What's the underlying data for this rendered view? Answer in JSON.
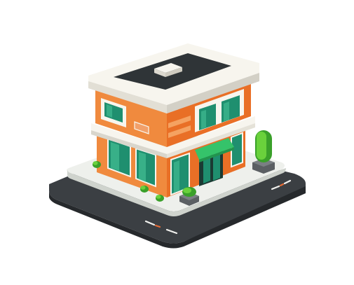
{
  "scene": {
    "subject": "isometric-building",
    "colors": {
      "background": "#ffffff",
      "road": "#3b3f43",
      "road_edge": "#2a2d30",
      "road_stripe": "#f1f1ee",
      "road_stripe_accent": "#e76c36",
      "sidewalk": "#eef0ec",
      "sidewalk_side": "#cfd3cd",
      "wall_front": "#f08a3e",
      "wall_right": "#e96f26",
      "wall_dark": "#c95818",
      "trim": "#f7f5ee",
      "trim_shadow": "#d9d6cc",
      "roof": "#2f3437",
      "glass": "#1f8f6f",
      "glass_light": "#49c79a",
      "awning": "#35c36a",
      "plant": "#6ad13c",
      "plant_dark": "#3aa02a",
      "planter": "#5b5f63"
    }
  }
}
